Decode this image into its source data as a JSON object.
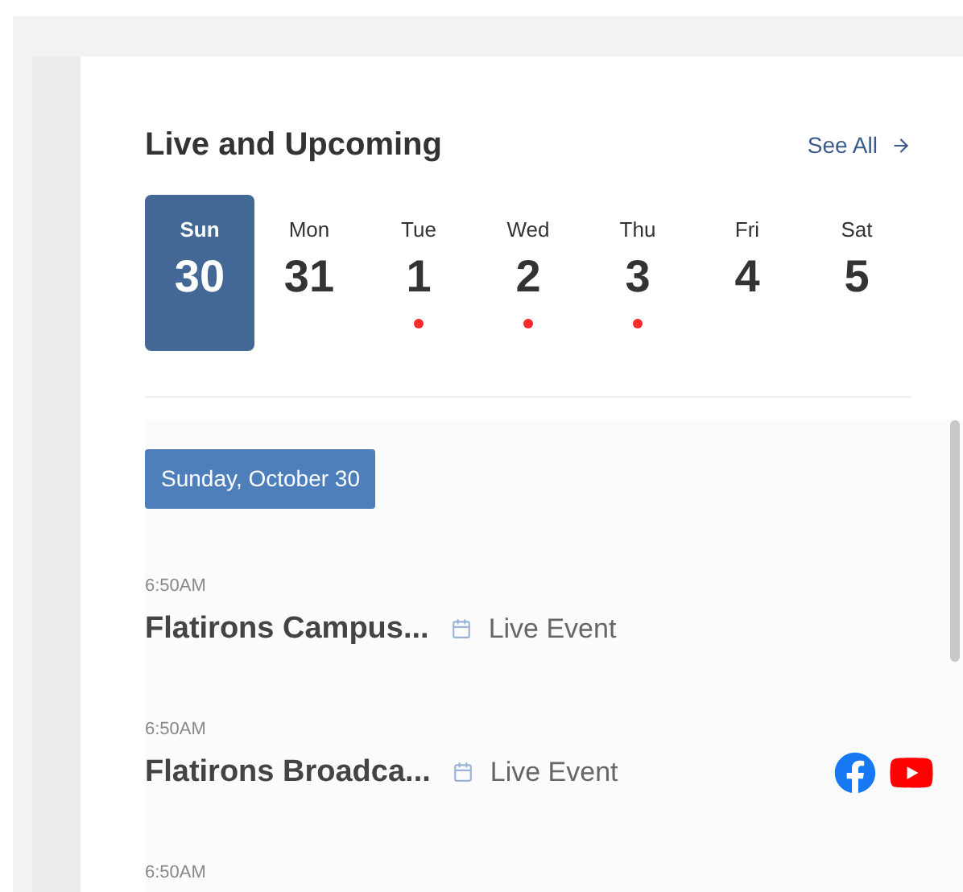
{
  "header": {
    "title": "Live and Upcoming",
    "see_all": "See All"
  },
  "days": [
    {
      "weekday": "Sun",
      "date": "30",
      "selected": true,
      "has_events": false
    },
    {
      "weekday": "Mon",
      "date": "31",
      "selected": false,
      "has_events": false
    },
    {
      "weekday": "Tue",
      "date": "1",
      "selected": false,
      "has_events": true
    },
    {
      "weekday": "Wed",
      "date": "2",
      "selected": false,
      "has_events": true
    },
    {
      "weekday": "Thu",
      "date": "3",
      "selected": false,
      "has_events": true
    },
    {
      "weekday": "Fri",
      "date": "4",
      "selected": false,
      "has_events": false
    },
    {
      "weekday": "Sat",
      "date": "5",
      "selected": false,
      "has_events": false
    }
  ],
  "date_badge": "Sunday, October 30",
  "events": [
    {
      "time": "6:50AM",
      "title": "Flatirons Campus...",
      "type": "Live Event"
    },
    {
      "time": "6:50AM",
      "title": "Flatirons Broadca...",
      "type": "Live Event",
      "social_links": [
        {
          "kind": "facebook"
        },
        {
          "kind": "youtube"
        }
      ]
    },
    {
      "time": "6:50AM"
    }
  ]
}
